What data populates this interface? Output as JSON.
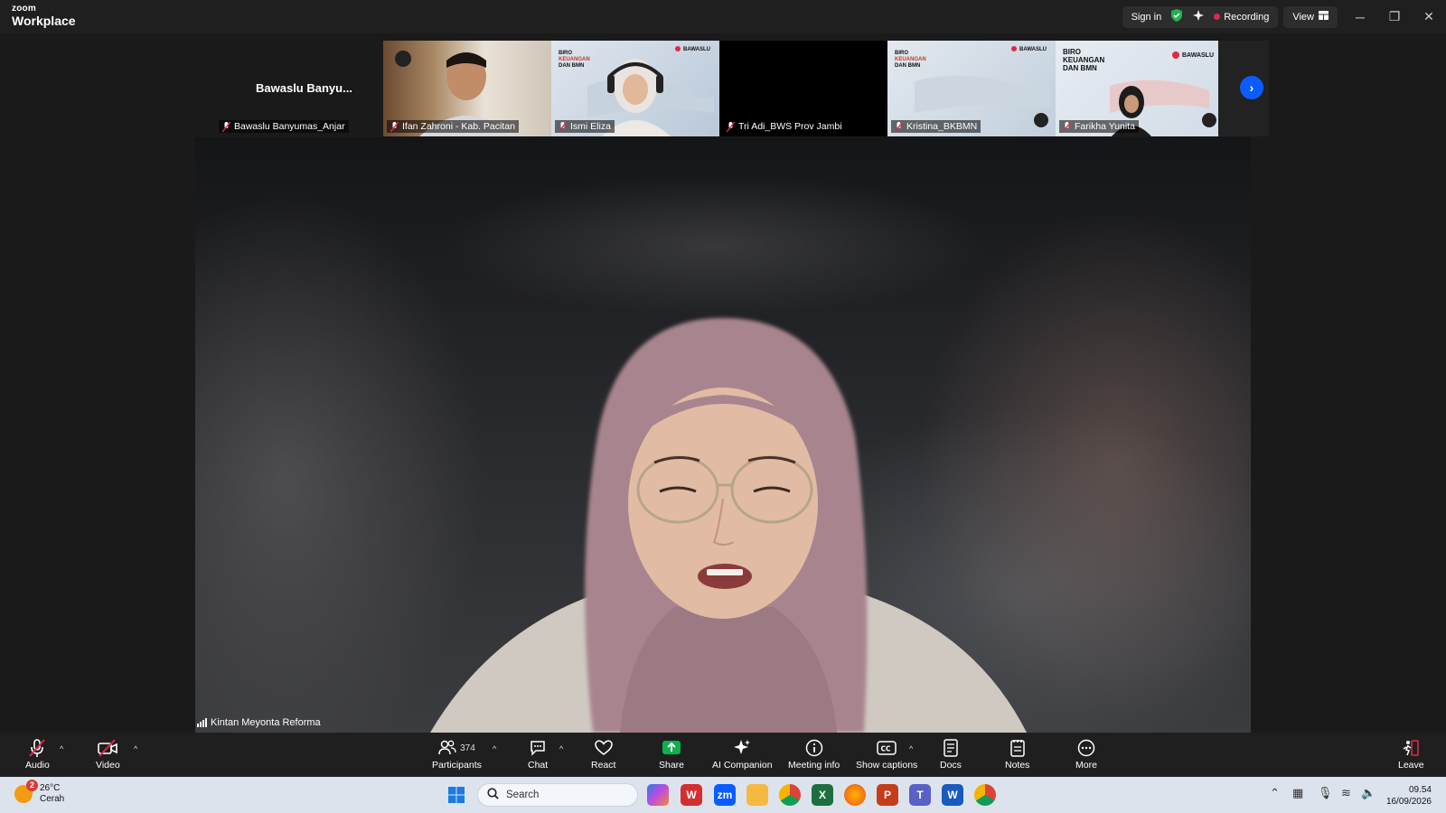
{
  "app": {
    "brand_small": "zoom",
    "brand_big": "Workplace"
  },
  "titlebar": {
    "sign_in": "Sign in",
    "recording": "Recording",
    "view": "View"
  },
  "gallery": {
    "first_tile_title": "Bawaslu Banyu...",
    "tiles": [
      {
        "name": "Bawaslu Banyumas_Anjar"
      },
      {
        "name": "Ifan Zahroni - Kab. Pacitan"
      },
      {
        "name": "Ismi Eliza"
      },
      {
        "name": "Tri Adi_BWS Prov Jambi"
      },
      {
        "name": "Kristina_BKBMN"
      },
      {
        "name": "Farikha Yunita"
      }
    ],
    "slide_text": {
      "biro": "BIRO",
      "keuangan": "KEUANGAN",
      "dan_bmn": "DAN BMN",
      "bawaslu": "BAWASLU"
    }
  },
  "main_video": {
    "speaker": "Kintan Meyonta Reforma"
  },
  "toolbar": {
    "audio": "Audio",
    "video": "Video",
    "participants": "Participants",
    "participants_count": "374",
    "chat": "Chat",
    "react": "React",
    "share": "Share",
    "ai_companion": "AI Companion",
    "meeting_info": "Meeting info",
    "show_captions": "Show captions",
    "docs": "Docs",
    "notes": "Notes",
    "more": "More",
    "leave": "Leave"
  },
  "taskbar": {
    "weather_temp": "26°C",
    "weather_desc": "Cerah",
    "weather_badge": "2",
    "search_placeholder": "Search",
    "time": "09.54",
    "date": "16/09/2026"
  },
  "colors": {
    "accent": "#0b5cff",
    "share": "#0bb14a",
    "leave": "#e0284a"
  }
}
